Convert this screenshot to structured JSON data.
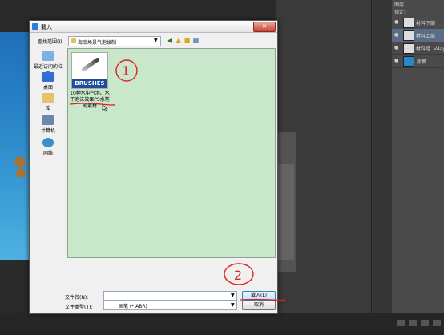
{
  "dialog": {
    "title": "载入",
    "close_label": "✕",
    "look_in_label": "查找范围(I):",
    "look_in_value": "海底场景气泡绘制",
    "toolbar_icons": [
      "back-icon",
      "up-folder-icon",
      "new-folder-icon",
      "view-menu-icon"
    ],
    "places": [
      {
        "label": "最近访问的位置",
        "icon": "recent-places-icon"
      },
      {
        "label": "桌面",
        "icon": "desktop-icon"
      },
      {
        "label": "库",
        "icon": "libraries-icon"
      },
      {
        "label": "计算机",
        "icon": "computer-icon"
      },
      {
        "label": "网络",
        "icon": "network-icon"
      }
    ],
    "files": [
      {
        "name": "10种水中气泡、水下泡沫效果PS水笔刷素材",
        "thumb_label": "BRUSHES"
      }
    ],
    "file_name_label": "文件名(N):",
    "file_name_value": "",
    "file_type_label": "文件类型(T):",
    "file_type_value": "画笔 (*.ABR)",
    "load_button": "载入(L)",
    "cancel_button": "取消"
  },
  "annotations": {
    "mark1": "1",
    "mark2": "2",
    "color": "#e0201e"
  },
  "layers": {
    "header_label": "图层",
    "lock_label": "锁定:",
    "items": [
      {
        "label": "材料下部"
      },
      {
        "label": "材料上部"
      },
      {
        "label": "材料组 .V4ayC"
      },
      {
        "label": "背景"
      }
    ]
  },
  "colors": {
    "file_area": "#c8e7cb",
    "ps_bg": "#2a2a2a",
    "brush_band": "#1d4d9c"
  }
}
